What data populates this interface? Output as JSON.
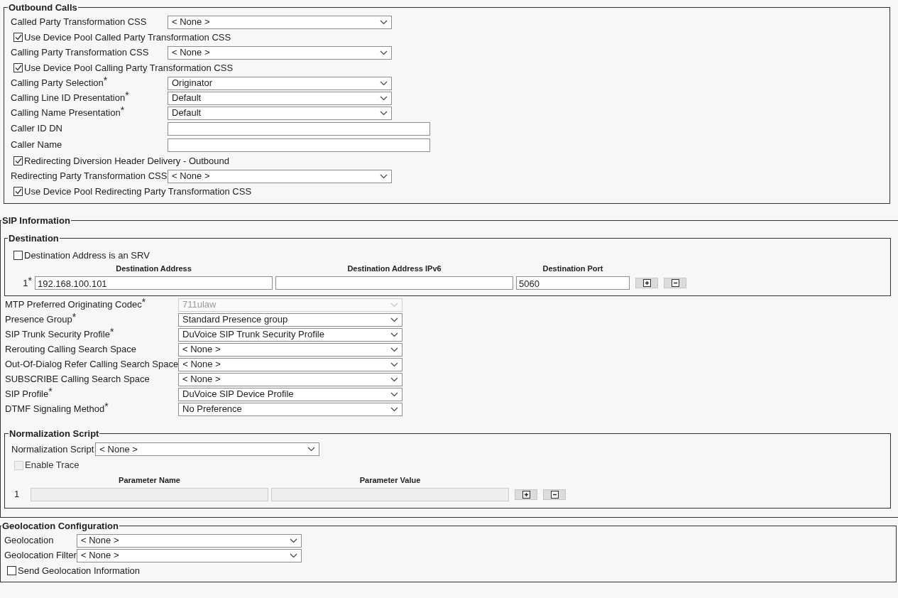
{
  "outbound_calls": {
    "title": "Outbound Calls",
    "items": [
      {
        "kind": "select",
        "label": "Called Party Transformation CSS",
        "value": "< None >"
      },
      {
        "kind": "checkbox",
        "label": "Use Device Pool Called Party Transformation CSS",
        "checked": true
      },
      {
        "kind": "select",
        "label": "Calling Party Transformation CSS",
        "value": "< None >"
      },
      {
        "kind": "checkbox",
        "label": "Use Device Pool Calling Party Transformation CSS",
        "checked": true
      },
      {
        "kind": "select",
        "label": "Calling Party Selection",
        "mark": "*",
        "value": "Originator"
      },
      {
        "kind": "select",
        "label": "Calling Line ID Presentation",
        "mark": "*",
        "value": "Default"
      },
      {
        "kind": "select",
        "label": "Calling Name Presentation",
        "mark": "*",
        "value": "Default"
      },
      {
        "kind": "text",
        "label": "Caller ID DN"
      },
      {
        "kind": "text",
        "label": "Caller Name"
      },
      {
        "kind": "checkbox",
        "label": "Redirecting Diversion Header Delivery - Outbound",
        "checked": true
      },
      {
        "kind": "select",
        "label": "Redirecting Party Transformation CSS",
        "value": "< None >"
      },
      {
        "kind": "checkbox",
        "label": "Use Device Pool Redirecting Party Transformation CSS",
        "checked": true
      }
    ]
  },
  "sip_information": {
    "title": "SIP Information",
    "destination": {
      "title": "Destination",
      "srv": {
        "label": "Destination Address is an SRV",
        "checked": false
      },
      "columns": [
        "Destination Address",
        "Destination Address IPv6",
        "Destination Port"
      ],
      "rows": [
        {
          "index": "1",
          "mark": "*",
          "address": "192.168.100.101",
          "port": "5060"
        }
      ]
    },
    "items": [
      {
        "kind": "select",
        "label": "MTP Preferred Originating Codec",
        "mark": "*",
        "value": "711ulaw",
        "disabled": true
      },
      {
        "kind": "select",
        "label": "Presence Group",
        "mark": "*",
        "value": "Standard Presence group",
        "disabled": false
      },
      {
        "kind": "select",
        "label": "SIP Trunk Security Profile",
        "mark": "*",
        "value": "DuVoice SIP Trunk Security Profile",
        "disabled": false
      },
      {
        "kind": "select",
        "label": "Rerouting Calling Search Space",
        "value": "< None >",
        "disabled": false
      },
      {
        "kind": "select",
        "label": "Out-Of-Dialog Refer Calling Search Space",
        "value": "< None >",
        "disabled": false
      },
      {
        "kind": "select",
        "label": "SUBSCRIBE Calling Search Space",
        "value": "< None >",
        "disabled": false
      },
      {
        "kind": "select",
        "label": "SIP Profile",
        "mark": "*",
        "value": "DuVoice SIP Device Profile",
        "disabled": false
      },
      {
        "kind": "select",
        "label": "DTMF Signaling Method",
        "mark": "*",
        "value": "No Preference",
        "disabled": false
      }
    ],
    "normalization": {
      "title": "Normalization Script",
      "script": {
        "label": "Normalization Script",
        "value": "< None >"
      },
      "trace": {
        "label": "Enable Trace",
        "checked": false,
        "disabled": true
      },
      "columns": [
        "Parameter Name",
        "Parameter Value"
      ],
      "rows": [
        {
          "index": "1",
          "disabled": true
        }
      ]
    }
  },
  "geolocation": {
    "title": "Geolocation Configuration",
    "items": [
      {
        "kind": "select",
        "label": "Geolocation",
        "value": "< None >"
      },
      {
        "kind": "select",
        "label": "Geolocation Filter",
        "value": "< None >"
      },
      {
        "kind": "checkbox",
        "label": "Send Geolocation Information",
        "checked": false
      }
    ]
  }
}
